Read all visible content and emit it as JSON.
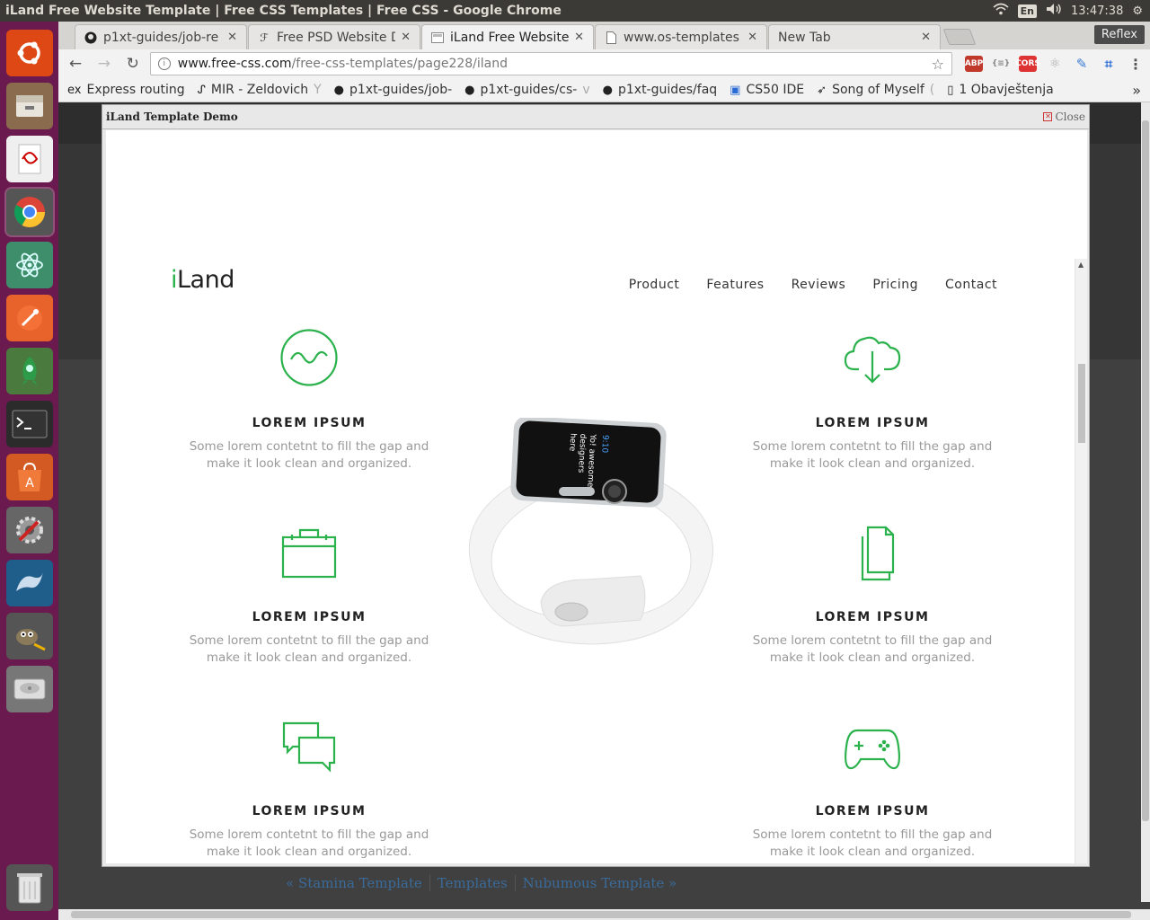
{
  "os": {
    "window_title": "iLand Free Website Template | Free CSS Templates | Free CSS - Google Chrome",
    "lang": "En",
    "clock": "13:47:38",
    "launcher": [
      "ubuntu-icon",
      "files-icon",
      "document-viewer-icon",
      "chrome-icon",
      "atom-icon",
      "postman-icon",
      "rocket-icon",
      "terminal-icon",
      "software-center-icon",
      "settings-icon",
      "mysql-workbench-icon",
      "gimp-icon",
      "disk-icon",
      "trash-icon"
    ]
  },
  "browser": {
    "tabs": [
      {
        "label": "p1xt-guides/job-re",
        "icon": "github-icon"
      },
      {
        "label": "Free PSD Website D",
        "icon": "psd-icon"
      },
      {
        "label": "iLand Free Website",
        "icon": "css-icon"
      },
      {
        "label": "www.os-templates",
        "icon": "page-icon"
      },
      {
        "label": "New Tab",
        "icon": ""
      }
    ],
    "profile": "Reflex",
    "url_host": "www.free-css.com",
    "url_path": "/free-css-templates/page228/iland",
    "bookmarks": [
      {
        "label": "Express routing",
        "icon": "ex"
      },
      {
        "label": "MIR - Zeldovich",
        "fade": "Y"
      },
      {
        "label": "p1xt-guides/job-"
      },
      {
        "label": "p1xt-guides/cs-",
        "fade": "v"
      },
      {
        "label": "p1xt-guides/faq"
      },
      {
        "label": "CS50 IDE"
      },
      {
        "label": "Song of Myself",
        "fade": "("
      },
      {
        "label": "1 Obavještenja"
      }
    ]
  },
  "modal": {
    "title": "iLand Template Demo",
    "close": "Close"
  },
  "site": {
    "logo_i": "i",
    "logo_rest": "Land",
    "nav": [
      "Product",
      "Features",
      "Reviews",
      "Pricing",
      "Contact"
    ],
    "features": [
      {
        "title": "LOREM IPSUM",
        "text": "Some lorem contetnt to fill the gap and make it look clean and organized.",
        "icon": "wave-icon"
      },
      {
        "title": "LOREM IPSUM",
        "text": "Some lorem contetnt to fill the gap and make it look clean and organized.",
        "icon": "cloud-download-icon"
      },
      {
        "title": "LOREM IPSUM",
        "text": "Some lorem contetnt to fill the gap and make it look clean and organized.",
        "icon": "briefcase-icon"
      },
      {
        "title": "LOREM IPSUM",
        "text": "Some lorem contetnt to fill the gap and make it look clean and organized.",
        "icon": "documents-icon"
      },
      {
        "title": "LOREM IPSUM",
        "text": "Some lorem contetnt to fill the gap and make it look clean and organized.",
        "icon": "chat-icon"
      },
      {
        "title": "LOREM IPSUM",
        "text": "Some lorem contetnt to fill the gap and make it look clean and organized.",
        "icon": "gamepad-icon"
      }
    ],
    "accent": "#2bb24c"
  },
  "pager": {
    "prev": "« Stamina Template",
    "index": "Templates",
    "next": "Nubumous Template »"
  }
}
